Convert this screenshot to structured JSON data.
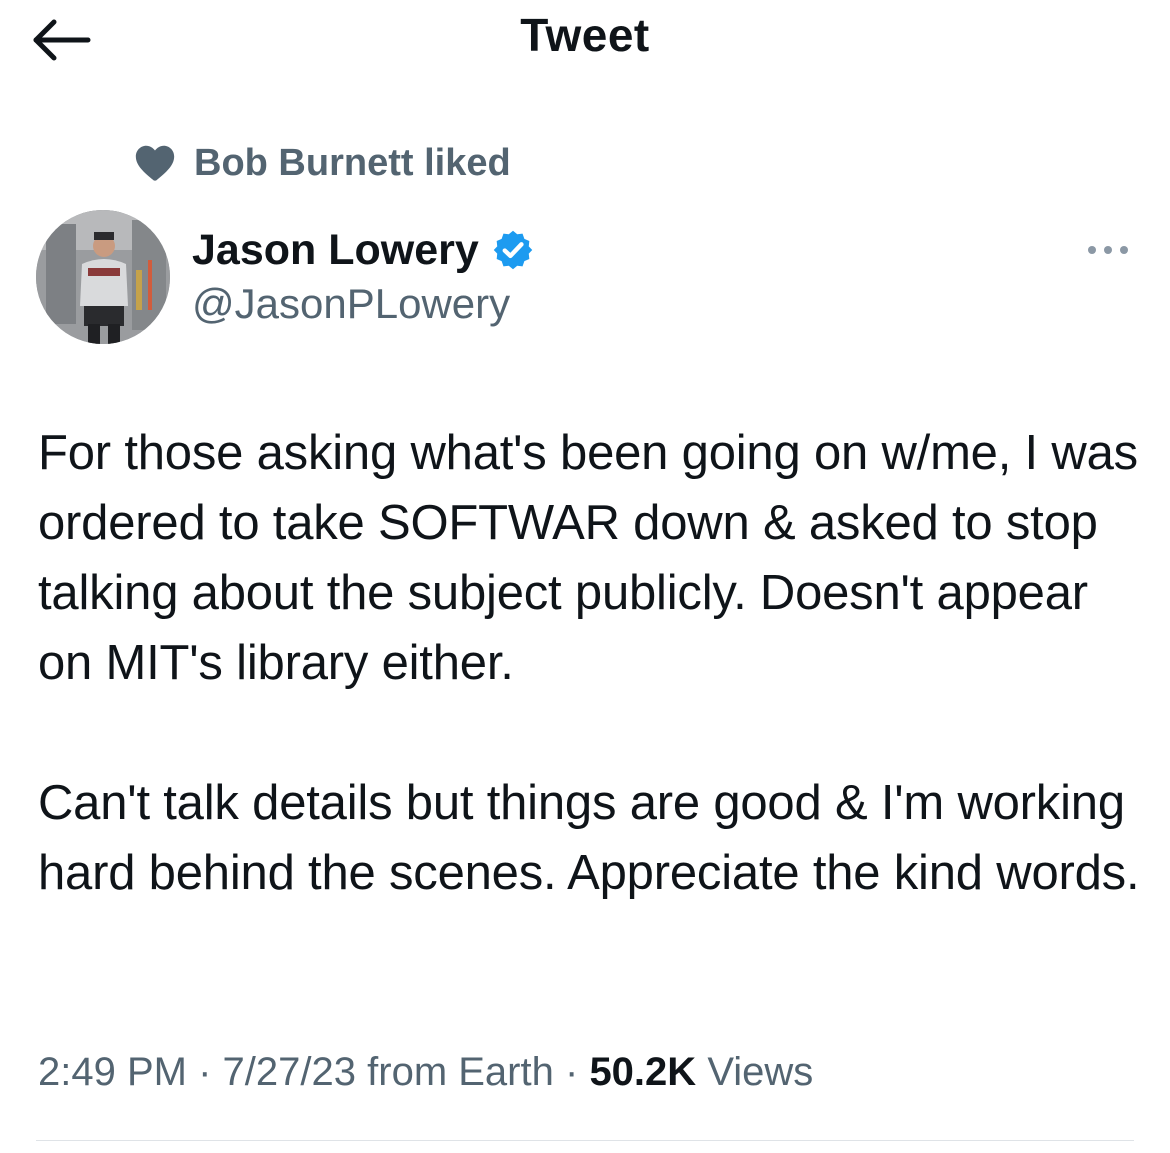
{
  "header": {
    "title": "Tweet",
    "back_icon": "arrow-left-icon"
  },
  "social_context": {
    "icon": "heart-icon",
    "text": "Bob Burnett liked"
  },
  "author": {
    "name": "Jason Lowery",
    "handle": "@JasonPLowery",
    "verified_icon": "verified-badge-icon",
    "verified_color": "#1d9bf0"
  },
  "more_icon": "more-horizontal-icon",
  "tweet": {
    "paragraph_1": "For those asking what's been going on w/me, I was ordered to take SOFTWAR down & asked to stop talking about the subject publicly. Doesn't appear on MIT's library either.",
    "paragraph_2": "Can't talk details but things are good & I'm working hard behind the scenes. Appreciate the kind words."
  },
  "meta": {
    "time": "2:49 PM",
    "separator": "·",
    "date": "7/27/23",
    "source": "from Earth",
    "views_count": "50.2K",
    "views_label": "Views"
  },
  "colors": {
    "text_primary": "#0f1419",
    "text_secondary": "#536471",
    "divider": "#dfe3e7"
  }
}
